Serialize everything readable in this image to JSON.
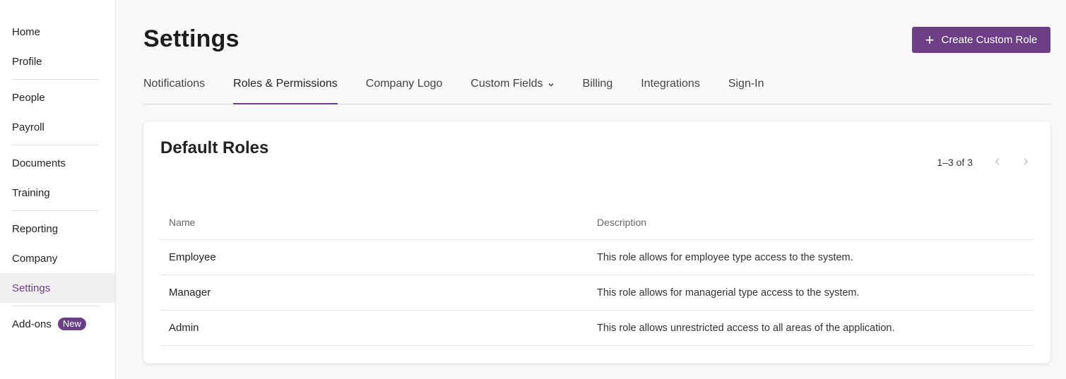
{
  "sidebar": {
    "items": [
      {
        "label": "Home"
      },
      {
        "label": "Profile"
      },
      {
        "label": "People"
      },
      {
        "label": "Payroll"
      },
      {
        "label": "Documents"
      },
      {
        "label": "Training"
      },
      {
        "label": "Reporting"
      },
      {
        "label": "Company"
      },
      {
        "label": "Settings"
      },
      {
        "label": "Add-ons",
        "badge": "New"
      }
    ],
    "active": "Settings"
  },
  "header": {
    "title": "Settings",
    "create_button_label": "Create Custom Role",
    "create_button_icon": "plus-icon"
  },
  "tabs": [
    {
      "label": "Notifications"
    },
    {
      "label": "Roles & Permissions",
      "active": true
    },
    {
      "label": "Company Logo"
    },
    {
      "label": "Custom Fields",
      "icon": "chevron-down-icon"
    },
    {
      "label": "Billing"
    },
    {
      "label": "Integrations"
    },
    {
      "label": "Sign-In"
    }
  ],
  "card": {
    "title": "Default Roles",
    "pagination": {
      "text": "1–3 of 3",
      "prev_icon": "chevron-left-icon",
      "next_icon": "chevron-right-icon"
    },
    "table": {
      "columns": [
        "Name",
        "Description"
      ],
      "rows": [
        {
          "name": "Employee",
          "description": "This role allows for employee type access to the system."
        },
        {
          "name": "Manager",
          "description": "This role allows for managerial type access to the system."
        },
        {
          "name": "Admin",
          "description": "This role allows unrestricted access to all areas of the application."
        }
      ]
    }
  },
  "colors": {
    "accent": "#6d4086",
    "active_nav_bg": "#f1eff2",
    "page_bg": "#f8f8f8"
  }
}
